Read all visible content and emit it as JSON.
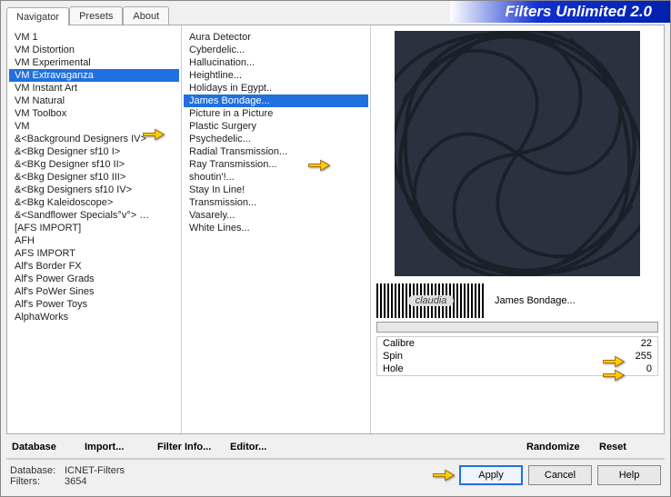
{
  "app": {
    "title": "Filters Unlimited 2.0"
  },
  "tabs": [
    {
      "label": "Navigator"
    },
    {
      "label": "Presets"
    },
    {
      "label": "About"
    }
  ],
  "categories": [
    "VM 1",
    "VM Distortion",
    "VM Experimental",
    "VM Extravaganza",
    "VM Instant Art",
    "VM Natural",
    "VM Toolbox",
    "VM",
    "&<Background Designers IV>",
    "&<Bkg Designer sf10 I>",
    "&<BKg Designer sf10 II>",
    "&<Bkg Designer sf10 III>",
    "&<Bkg Designers sf10 IV>",
    "&<Bkg Kaleidoscope>",
    "&<Sandflower Specials°v°> …",
    "[AFS IMPORT]",
    "AFH",
    "AFS IMPORT",
    "Alf's Border FX",
    "Alf's Power Grads",
    "Alf's PoWer Sines",
    "Alf's Power Toys",
    "AlphaWorks"
  ],
  "categories_selected_index": 3,
  "filters": [
    "Aura Detector",
    "Cyberdelic...",
    "Hallucination...",
    "Heightline...",
    "Holidays in Egypt..",
    "James Bondage...",
    "Picture in a Picture",
    "Plastic Surgery",
    "Psychedelic...",
    "Radial Transmission...",
    "Ray Transmission...",
    "shoutin'!...",
    "Stay In Line!",
    "Transmission...",
    "Vasarely...",
    "White Lines..."
  ],
  "filters_selected_index": 5,
  "current_filter_name": "James Bondage...",
  "params": [
    {
      "label": "Calibre",
      "value": 22
    },
    {
      "label": "Spin",
      "value": 255
    },
    {
      "label": "Hole",
      "value": 0
    }
  ],
  "toolbar": {
    "database": "Database",
    "import": "Import...",
    "filter_info": "Filter Info...",
    "editor": "Editor...",
    "randomize": "Randomize",
    "reset": "Reset"
  },
  "footer": {
    "database_label": "Database:",
    "database_value": "ICNET-Filters",
    "filters_label": "Filters:",
    "filters_value": "3654",
    "apply": "Apply",
    "cancel": "Cancel",
    "help": "Help"
  },
  "logo_text": "claudia"
}
